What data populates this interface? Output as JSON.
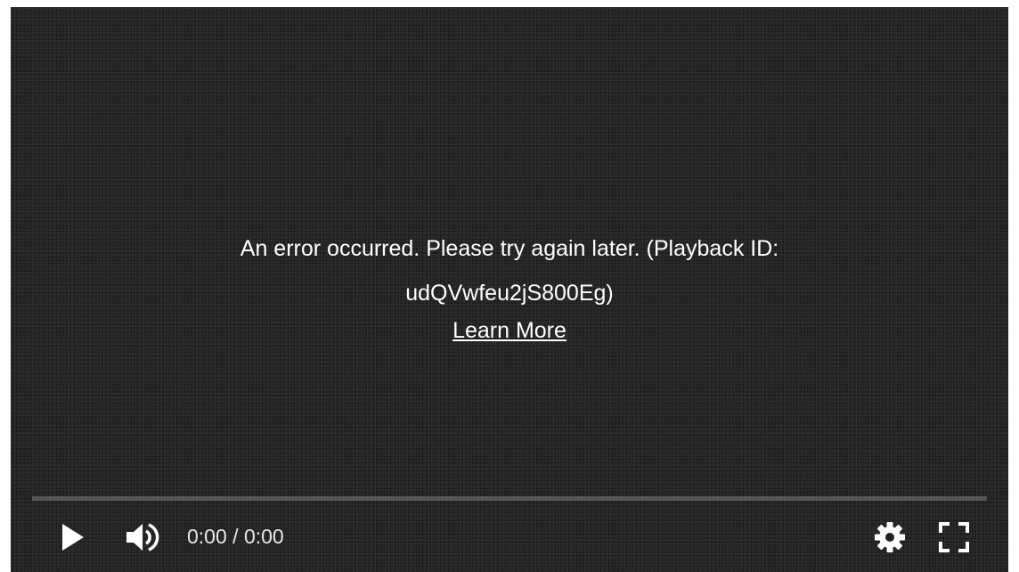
{
  "error": {
    "message": "An error occurred. Please try again later. (Playback ID: udQVwfeu2jS800Eg)",
    "learn_more": "Learn More"
  },
  "controls": {
    "current_time": "0:00",
    "separator": " / ",
    "duration": "0:00",
    "progress": 0,
    "play_icon": "play-icon",
    "volume_icon": "volume-icon",
    "settings_icon": "gear-icon",
    "fullscreen_icon": "fullscreen-icon"
  },
  "colors": {
    "background": "#202020",
    "text": "#ffffff",
    "progress_track": "rgba(255,255,255,0.22)",
    "progress_fill": "#ff0000"
  }
}
